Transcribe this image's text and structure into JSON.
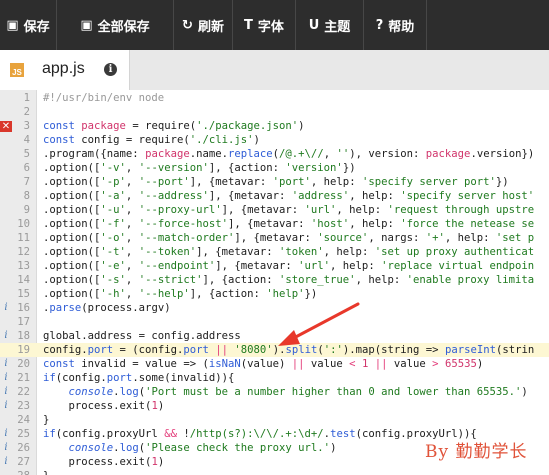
{
  "toolbar": {
    "buttons": [
      {
        "label": "保存",
        "icon": "save-icon",
        "glyph": "▣"
      },
      {
        "label": "全部保存",
        "icon": "save-all-icon",
        "glyph": "▣"
      },
      {
        "label": "刷新",
        "icon": "refresh-icon",
        "glyph": "↻"
      },
      {
        "label": "字体",
        "icon": "font-icon",
        "glyph": "T"
      },
      {
        "label": "主题",
        "icon": "theme-icon",
        "glyph": "U"
      },
      {
        "label": "帮助",
        "icon": "help-icon",
        "glyph": "?"
      }
    ]
  },
  "tab": {
    "badge": "JS",
    "filename": "app.js",
    "info": "i"
  },
  "editor": {
    "lines": [
      {
        "n": "1",
        "mark": "",
        "html": "<span class=\"cm\">#!/usr/bin/env node</span>"
      },
      {
        "n": "2",
        "mark": "",
        "html": ""
      },
      {
        "n": "3",
        "mark": "err",
        "html": "<span class=\"kw\">const</span> <span class=\"var\">package</span> = require(<span class=\"str\">'./package.json'</span>)"
      },
      {
        "n": "4",
        "mark": "",
        "html": "<span class=\"kw\">const</span> config = require(<span class=\"str\">'./cli.js'</span>)"
      },
      {
        "n": "5",
        "mark": "",
        "html": ".program({name: <span class=\"var\">package</span>.name.<span class=\"prop\">replace</span>(<span class=\"str\">/@.+\\//</span>, <span class=\"str\">''</span>), version: <span class=\"var\">package</span>.version})"
      },
      {
        "n": "6",
        "mark": "",
        "html": ".option([<span class=\"str\">'-v'</span>, <span class=\"str\">'--version'</span>], {action: <span class=\"str\">'version'</span>})"
      },
      {
        "n": "7",
        "mark": "",
        "html": ".option([<span class=\"str\">'-p'</span>, <span class=\"str\">'--port'</span>], {metavar: <span class=\"str\">'port'</span>, help: <span class=\"str\">'specify server port'</span>})"
      },
      {
        "n": "8",
        "mark": "",
        "html": ".option([<span class=\"str\">'-a'</span>, <span class=\"str\">'--address'</span>], {metavar: <span class=\"str\">'address'</span>, help: <span class=\"str\">'specify server host'</span>"
      },
      {
        "n": "9",
        "mark": "",
        "html": ".option([<span class=\"str\">'-u'</span>, <span class=\"str\">'--proxy-url'</span>], {metavar: <span class=\"str\">'url'</span>, help: <span class=\"str\">'request through upstre</span>"
      },
      {
        "n": "10",
        "mark": "",
        "html": ".option([<span class=\"str\">'-f'</span>, <span class=\"str\">'--force-host'</span>], {metavar: <span class=\"str\">'host'</span>, help: <span class=\"str\">'force the netease se</span>"
      },
      {
        "n": "11",
        "mark": "",
        "html": ".option([<span class=\"str\">'-o'</span>, <span class=\"str\">'--match-order'</span>], {metavar: <span class=\"str\">'source'</span>, nargs: <span class=\"str\">'+'</span>, help: <span class=\"str\">'set p</span>"
      },
      {
        "n": "12",
        "mark": "",
        "html": ".option([<span class=\"str\">'-t'</span>, <span class=\"str\">'--token'</span>], {metavar: <span class=\"str\">'token'</span>, help: <span class=\"str\">'set up proxy authenticat</span>"
      },
      {
        "n": "13",
        "mark": "",
        "html": ".option([<span class=\"str\">'-e'</span>, <span class=\"str\">'--endpoint'</span>], {metavar: <span class=\"str\">'url'</span>, help: <span class=\"str\">'replace virtual endpoin</span>"
      },
      {
        "n": "14",
        "mark": "",
        "html": ".option([<span class=\"str\">'-s'</span>, <span class=\"str\">'--strict'</span>], {action: <span class=\"str\">'store_true'</span>, help: <span class=\"str\">'enable proxy limita</span>"
      },
      {
        "n": "15",
        "mark": "",
        "html": ".option([<span class=\"str\">'-h'</span>, <span class=\"str\">'--help'</span>], {action: <span class=\"str\">'help'</span>})"
      },
      {
        "n": "16",
        "mark": "i",
        "html": ".<span class=\"prop\">parse</span>(process.argv)"
      },
      {
        "n": "17",
        "mark": "",
        "html": ""
      },
      {
        "n": "18",
        "mark": "i",
        "html": "global.address = config.address"
      },
      {
        "n": "19",
        "mark": "",
        "hl": true,
        "html": "config.<span class=\"prop\">port</span> = (config.<span class=\"prop\">port</span> <span class=\"op\">||</span> <span class=\"str\">'8080'</span>).<span class=\"prop\">split</span>(<span class=\"str\">':'</span>).map(string =&gt; <span class=\"prop\">parseInt</span>(strin"
      },
      {
        "n": "20",
        "mark": "i",
        "html": "<span class=\"kw\">const</span> invalid = value =&gt; (<span class=\"prop\">isNaN</span>(value) <span class=\"op\">||</span> value <span class=\"op\">&lt;</span> <span class=\"num\">1</span> <span class=\"op\">||</span> value <span class=\"op\">&gt;</span> <span class=\"num\">65535</span>)"
      },
      {
        "n": "21",
        "mark": "i",
        "html": "<span class=\"kw\">if</span>(config.<span class=\"prop\">port</span>.some(invalid)){"
      },
      {
        "n": "22",
        "mark": "i",
        "html": "    <span class=\"fn\">console</span>.<span class=\"prop\">log</span>(<span class=\"str\">'Port must be a number higher than 0 and lower than 65535.'</span>)"
      },
      {
        "n": "23",
        "mark": "i",
        "html": "    process.exit(<span class=\"num\">1</span>)"
      },
      {
        "n": "24",
        "mark": "",
        "html": "}"
      },
      {
        "n": "25",
        "mark": "i",
        "html": "<span class=\"kw\">if</span>(config.proxyUrl <span class=\"op\">&amp;&amp;</span> !<span class=\"str\">/http(s?):\\/\\/.+:\\d+/</span>.<span class=\"prop\">test</span>(config.proxyUrl)){"
      },
      {
        "n": "26",
        "mark": "i",
        "html": "    <span class=\"fn\">console</span>.<span class=\"prop\">log</span>(<span class=\"str\">'Please check the proxy url.'</span>)"
      },
      {
        "n": "27",
        "mark": "i",
        "html": "    process.exit(<span class=\"num\">1</span>)"
      },
      {
        "n": "28",
        "mark": "",
        "html": "}"
      }
    ]
  },
  "watermark": "By 勤勤学长"
}
